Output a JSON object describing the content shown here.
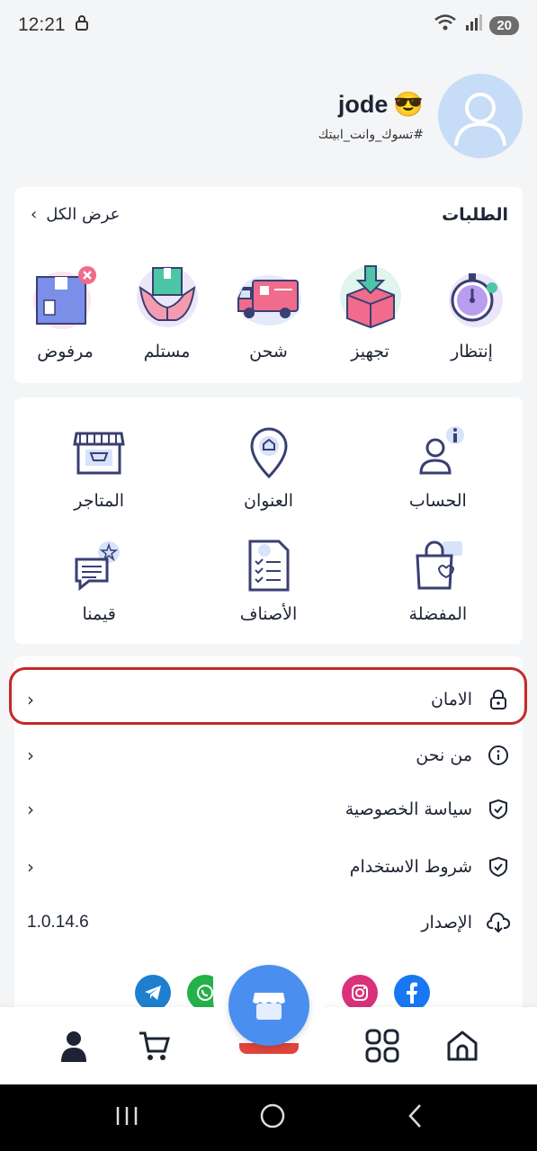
{
  "status_bar": {
    "time": "12:21",
    "battery": "20"
  },
  "profile": {
    "username": "jode",
    "emoji": "😎",
    "tagline": "#تسوك_وانت_ابيتك"
  },
  "orders": {
    "title": "الطلبات",
    "view_all": "عرض الكل",
    "items": [
      {
        "label": "إنتظار",
        "icon": "stopwatch-icon"
      },
      {
        "label": "تجهيز",
        "icon": "box-download-icon"
      },
      {
        "label": "شحن",
        "icon": "delivery-truck-icon"
      },
      {
        "label": "مستلم",
        "icon": "hands-box-icon"
      },
      {
        "label": "مرفوض",
        "icon": "rejected-box-icon"
      }
    ]
  },
  "shortcuts": [
    {
      "label": "الحساب",
      "icon": "account-icon"
    },
    {
      "label": "العنوان",
      "icon": "location-pin-icon"
    },
    {
      "label": "المتاجر",
      "icon": "store-icon"
    },
    {
      "label": "المفضلة",
      "icon": "favorites-bag-icon"
    },
    {
      "label": "الأصناف",
      "icon": "checklist-icon"
    },
    {
      "label": "قيمنا",
      "icon": "rate-chat-icon"
    }
  ],
  "menu": {
    "security": "الامان",
    "about": "من نحن",
    "privacy": "سياسة الخصوصية",
    "terms": "شروط الاستخدام",
    "version_label": "الإصدار",
    "version_value": "1.0.14.6"
  },
  "socials": [
    "telegram-icon",
    "whatsapp-icon",
    "linkedin-icon",
    "instagram-icon",
    "facebook-icon"
  ],
  "colors": {
    "accent": "#4a8ff0",
    "highlight": "#c62828",
    "avatar_bg": "#c6dcf7"
  }
}
